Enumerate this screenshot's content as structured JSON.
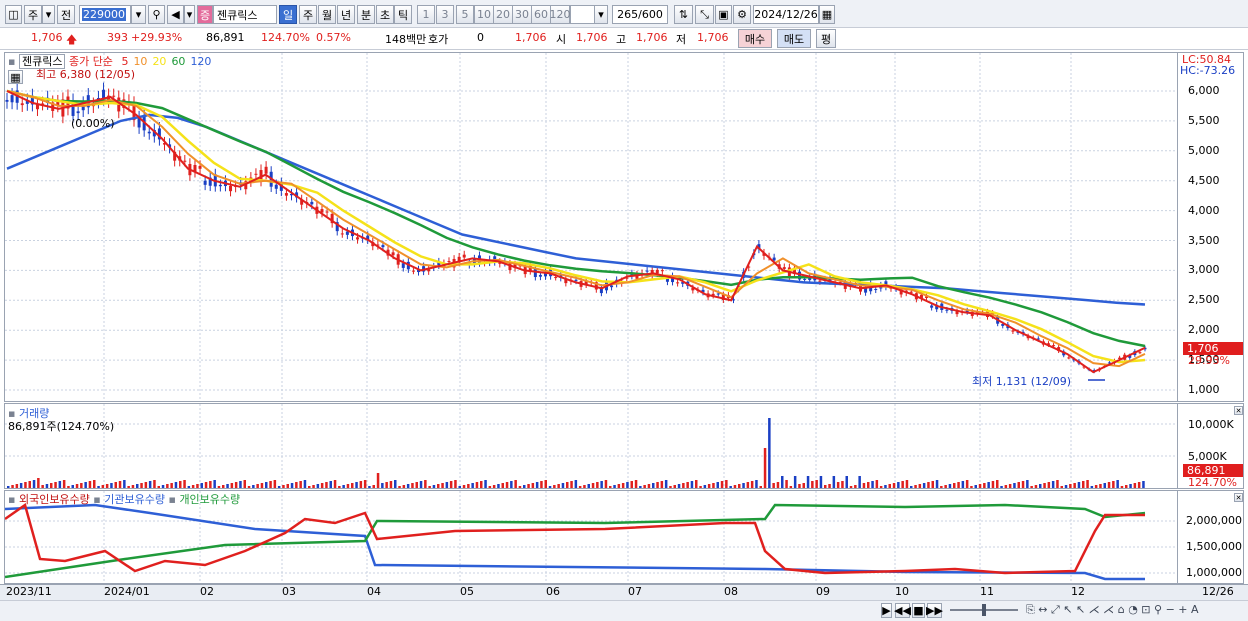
{
  "toolbar": {
    "type_main": "주",
    "type_prev": "전",
    "code": "229000",
    "stock_badge": "증",
    "stock_name": "젠큐릭스",
    "periods": [
      "일",
      "주",
      "월",
      "년",
      "분",
      "초",
      "틱"
    ],
    "minutes": [
      "1",
      "3",
      "5",
      "10",
      "20",
      "30",
      "60",
      "120"
    ],
    "count": "265",
    "count_total": "/600",
    "date": "2024/12/26"
  },
  "quote": {
    "price": "1,706",
    "change": "393",
    "change_pct": "+29.93%",
    "volume": "86,891",
    "volume_ratio": "124.70%",
    "turnover": "0.57%",
    "amount": "148백만",
    "hoga_label": "호가",
    "hoga_value": "0",
    "hoga_price": "1,706",
    "open_label": "시",
    "open": "1,706",
    "high_label": "고",
    "high": "1,706",
    "low_label": "저",
    "low": "1,706",
    "buy_btn": "매수",
    "sell_btn": "매도",
    "eval_btn": "평"
  },
  "price_panel": {
    "name": "젠큐릭스",
    "ma_prefix": "종가 단순",
    "ma_periods": [
      "5",
      "10",
      "20",
      "60",
      "120"
    ],
    "ma_colors": [
      "#e0201e",
      "#f0902a",
      "#f5e21a",
      "#1f9a3a",
      "#2e5fd6"
    ],
    "high_note": "최고 6,380 (12/05)",
    "high_pct": "(0.00%)",
    "low_note": "최저 1,131 (12/09)",
    "lc": "LC:50.84",
    "hc": "HC:-73.26",
    "last_tag": "1,706",
    "last_pct": "29.93%",
    "y_ticks": [
      "6,000",
      "5,500",
      "5,000",
      "4,500",
      "4,000",
      "3,500",
      "3,000",
      "2,500",
      "2,000",
      "1,500",
      "1,000"
    ]
  },
  "volume_panel": {
    "name": "거래량",
    "value": "86,891주(124.70%)",
    "y_ticks": [
      "10,000K",
      "5,000K"
    ],
    "last_tag": "86,891",
    "last_pct": "124.70%"
  },
  "holding_panel": {
    "foreign": "외국인보유수량",
    "institution": "기관보유수량",
    "individual": "개인보유수량",
    "y_ticks": [
      "2,000,000",
      "1,500,000",
      "1,000,000"
    ]
  },
  "dates": [
    "2023/11",
    "2024/01",
    "02",
    "03",
    "04",
    "05",
    "06",
    "07",
    "08",
    "09",
    "10",
    "11",
    "12",
    "12/26"
  ],
  "chart_data": {
    "type": "line",
    "title": "",
    "series": [
      {
        "name": "종가 단순 5",
        "values": [
          6000,
          5800,
          5700,
          5800,
          5900,
          5600,
          5200,
          4700,
          4500,
          4400,
          4600,
          4300,
          4000,
          3700,
          3500,
          3200,
          3000,
          3100,
          3200,
          3150,
          3000,
          2950,
          2800,
          2700,
          2900,
          2950,
          2850,
          2600,
          2500,
          3400,
          3000,
          2900,
          2800,
          2700,
          2750,
          2600,
          2400,
          2300,
          2250,
          2000,
          1800,
          1600,
          1300,
          1500,
          1706
        ]
      },
      {
        "name": "종가 단순 120",
        "values": [
          4700,
          4900,
          5100,
          5300,
          5500,
          5600,
          5550,
          5400,
          5200,
          5000,
          4800,
          4600,
          4400,
          4200,
          4000,
          3800,
          3600,
          3500,
          3400,
          3300,
          3200,
          3150,
          3100,
          3050,
          3000,
          2950,
          2900,
          2850,
          2800,
          2780,
          2760,
          2740,
          2720,
          2700,
          2660,
          2620,
          2580,
          2540,
          2500,
          2460,
          2430
        ]
      }
    ],
    "ylim": [
      1000,
      6300
    ]
  }
}
